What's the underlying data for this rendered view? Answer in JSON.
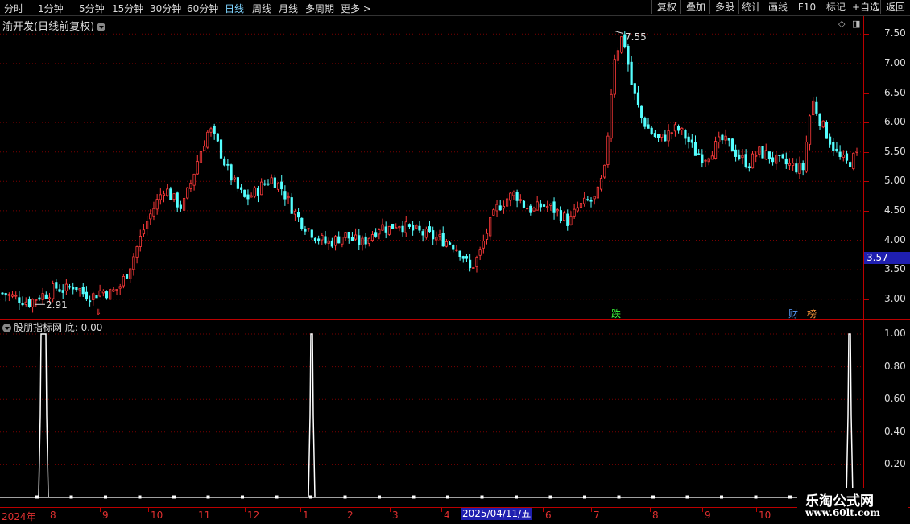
{
  "toolbar": {
    "periods": [
      "分时",
      "1分钟",
      "5分钟",
      "15分钟",
      "30分钟",
      "60分钟",
      "日线",
      "周线",
      "月线",
      "多周期",
      "更多 >"
    ],
    "active_period": "日线",
    "right_buttons": [
      "复权",
      "叠加",
      "多股",
      "统计",
      "画线",
      "F10",
      "标记",
      "+自选",
      "返回"
    ]
  },
  "main_panel": {
    "title": "渝开发(日线前复权)",
    "high_label": "7.55",
    "low_label": "2.91",
    "current_price_tag": "3.57",
    "y_ticks": [
      "7.50",
      "7.00",
      "6.50",
      "6.00",
      "5.50",
      "5.00",
      "4.50",
      "4.00",
      "3.50",
      "3.00"
    ],
    "markers": {
      "fall": "跌",
      "finance": "财",
      "rank": "榜",
      "arrow": "⇓"
    }
  },
  "indicator_panel": {
    "title": "股朋指标网 底: 0.00",
    "y_ticks": [
      "1.00",
      "0.80",
      "0.60",
      "0.40",
      "0.20"
    ]
  },
  "x_axis": {
    "year_label": "2024年",
    "months": [
      "8",
      "9",
      "10",
      "11",
      "12",
      "1",
      "2",
      "3",
      "4",
      "5",
      "6",
      "7",
      "8",
      "9",
      "10"
    ],
    "cursor_date": "2025/04/11/五"
  },
  "watermark": {
    "line1": "乐淘公式网",
    "line2": "www.60lt.com"
  },
  "colors": {
    "up": "#ff3a3a",
    "down": "#54ffff",
    "axis": "#b00000",
    "grid": "#7a0000",
    "accent": "#1f1fb0"
  },
  "chart_data": {
    "type": "candlestick",
    "ylim": [
      2.75,
      7.75
    ],
    "range_high": 7.55,
    "range_low": 2.91,
    "close_path": [
      3.1,
      3.05,
      3.0,
      2.95,
      3.05,
      3.1,
      3.2,
      3.15,
      3.25,
      3.1,
      3.05,
      3.15,
      3.1,
      3.2,
      3.5,
      3.9,
      4.3,
      4.6,
      4.9,
      4.7,
      4.55,
      5.0,
      5.5,
      5.9,
      5.6,
      5.2,
      4.9,
      4.7,
      4.8,
      4.95,
      5.05,
      4.9,
      4.6,
      4.35,
      4.2,
      4.05,
      3.95,
      4.0,
      4.1,
      4.0,
      3.95,
      4.1,
      4.25,
      4.2,
      4.3,
      4.2,
      4.15,
      4.1,
      4.05,
      4.0,
      3.95,
      3.8,
      3.5,
      3.75,
      4.2,
      4.55,
      4.7,
      4.8,
      4.6,
      4.5,
      4.6,
      4.55,
      4.45,
      4.3,
      4.55,
      4.65,
      4.7,
      5.2,
      7.1,
      7.5,
      6.6,
      6.1,
      5.85,
      5.7,
      5.8,
      5.9,
      5.75,
      5.5,
      5.4,
      5.55,
      5.7,
      5.6,
      5.4,
      5.3,
      5.5,
      5.45,
      5.35,
      5.3,
      5.25,
      5.2,
      6.4,
      6.0,
      5.7,
      5.4,
      5.3,
      5.45
    ]
  }
}
